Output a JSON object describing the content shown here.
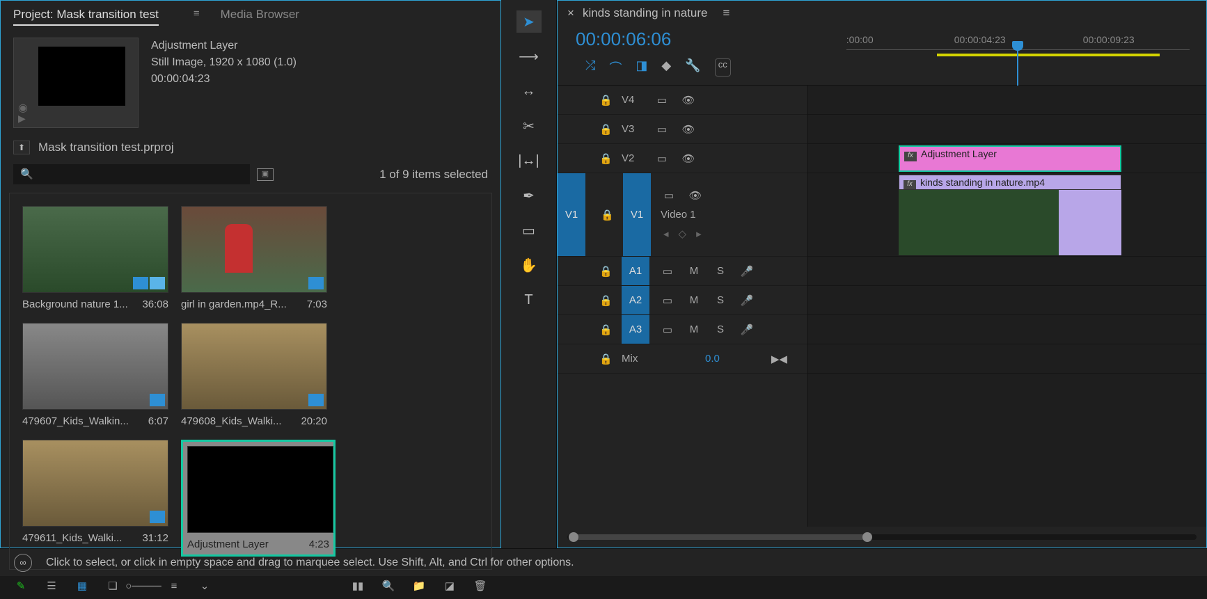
{
  "project": {
    "tab_project": "Project: Mask transition test",
    "tab_media": "Media Browser",
    "preview": {
      "title": "Adjustment Layer",
      "meta1": "Still Image, 1920 x 1080 (1.0)",
      "meta2": "00:00:04:23"
    },
    "project_file": "Mask transition test.prproj",
    "selection_info": "1 of 9 items selected",
    "bin_items": [
      {
        "name": "Background nature 1...",
        "dur": "36:08"
      },
      {
        "name": "girl in garden.mp4_R...",
        "dur": "7:03"
      },
      {
        "name": "479607_Kids_Walkin...",
        "dur": "6:07"
      },
      {
        "name": "479608_Kids_Walki...",
        "dur": "20:20"
      },
      {
        "name": "479611_Kids_Walki...",
        "dur": "31:12"
      },
      {
        "name": "Adjustment Layer",
        "dur": "4:23"
      }
    ]
  },
  "sequence": {
    "name": "kinds standing in nature",
    "timecode": "00:00:06:06",
    "ruler": [
      ":00:00",
      "00:00:04:23",
      "00:00:09:23"
    ],
    "tracks": {
      "v4": "V4",
      "v3": "V3",
      "v2": "V2",
      "v1": "V1",
      "video1": "Video 1",
      "a1": "A1",
      "a2": "A2",
      "a3": "A3",
      "mix": "Mix",
      "mix_val": "0.0",
      "m": "M",
      "s": "S"
    },
    "clips": {
      "adj": "Adjustment Layer",
      "vid": "kinds standing in nature.mp4"
    }
  },
  "status": "Click to select, or click in empty space and drag to marquee select. Use Shift, Alt, and Ctrl for other options."
}
